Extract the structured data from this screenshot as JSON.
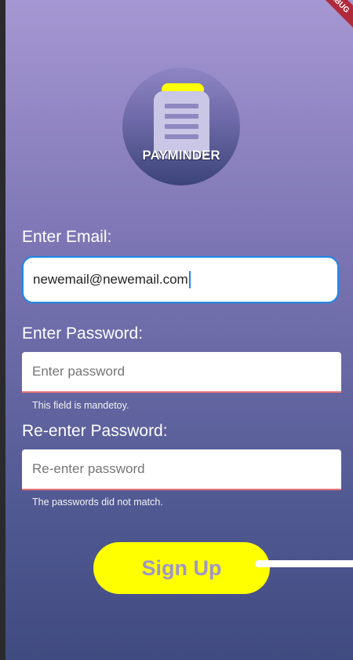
{
  "debug_banner": "DEBUG",
  "logo": {
    "text": "PAYMINDER",
    "icon": "clipboard-icon"
  },
  "email": {
    "label": "Enter Email:",
    "value": "newemail@newemail.com"
  },
  "password": {
    "label": "Enter Password:",
    "placeholder": "Enter password",
    "error": "This field is mandetoy."
  },
  "confirm_password": {
    "label": "Re-enter Password:",
    "placeholder": "Re-enter password",
    "error": "The passwords did not match."
  },
  "signup": {
    "label": "Sign Up"
  },
  "colors": {
    "accent": "#ffff00",
    "focus": "#1e88e5",
    "error": "#e57373",
    "button_text": "#9f96c8"
  }
}
